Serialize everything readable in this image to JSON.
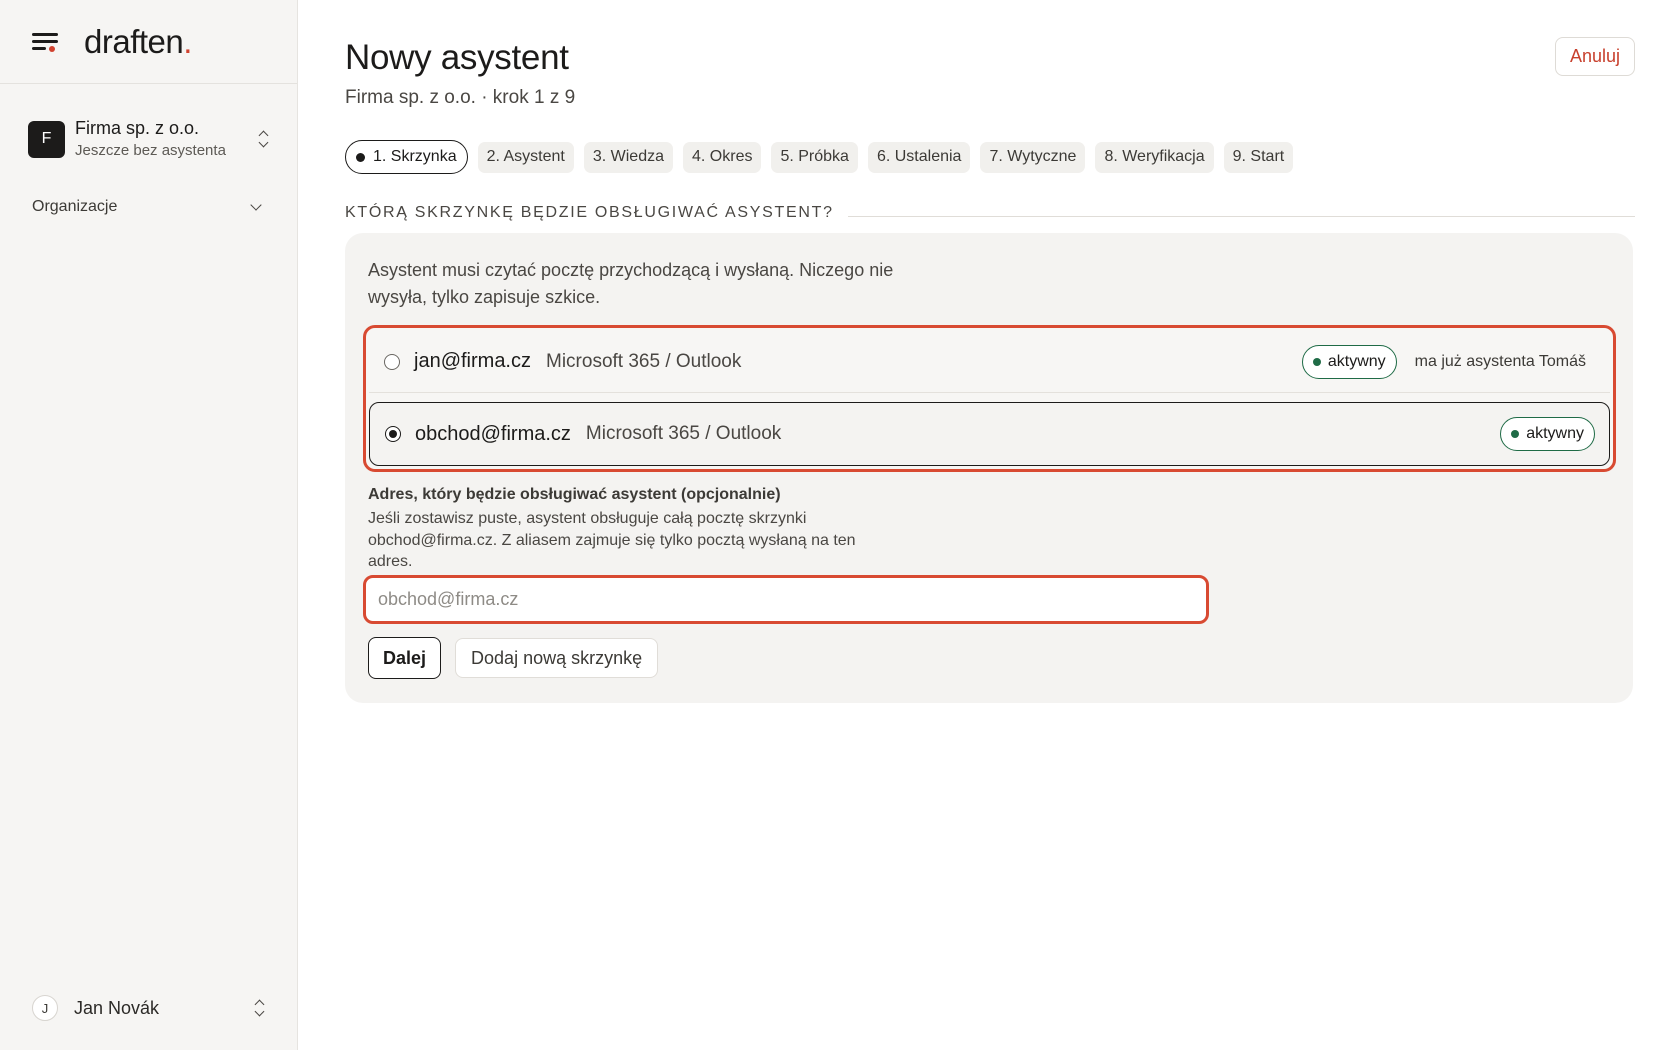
{
  "brand": {
    "name": "draften",
    "dot": "."
  },
  "sidebar": {
    "org": {
      "initial": "F",
      "name": "Firma sp. z o.o.",
      "subtitle": "Jeszcze bez asystenta"
    },
    "section_label": "Organizacje",
    "user": {
      "initial": "J",
      "name": "Jan Novák"
    }
  },
  "header": {
    "title": "Nowy asystent",
    "subtitle": "Firma sp. z o.o. · krok 1 z 9",
    "cancel_label": "Anuluj"
  },
  "steps": [
    {
      "label": "1. Skrzynka",
      "active": true
    },
    {
      "label": "2. Asystent"
    },
    {
      "label": "3. Wiedza"
    },
    {
      "label": "4. Okres"
    },
    {
      "label": "5. Próbka"
    },
    {
      "label": "6. Ustalenia"
    },
    {
      "label": "7. Wytyczne"
    },
    {
      "label": "8. Weryfikacja"
    },
    {
      "label": "9. Start"
    }
  ],
  "section": {
    "heading": "KTÓRĄ SKRZYNKĘ BĘDZIE OBSŁUGIWAĆ ASYSTENT?"
  },
  "card": {
    "description": "Asystent musi czytać pocztę przychodzącą i wysłaną. Niczego nie wysyła, tylko zapisuje szkice.",
    "mailboxes": [
      {
        "address": "jan@firma.cz",
        "provider": "Microsoft 365 / Outlook",
        "status": "aktywny",
        "note": "ma już asystenta Tomáš",
        "selected": false
      },
      {
        "address": "obchod@firma.cz",
        "provider": "Microsoft 365 / Outlook",
        "status": "aktywny",
        "note": "",
        "selected": true
      }
    ],
    "alias": {
      "label": "Adres, który będzie obsługiwać asystent (opcjonalnie)",
      "help": "Jeśli zostawisz puste, asystent obsługuje całą pocztę skrzynki obchod@firma.cz. Z aliasem zajmuje się tylko pocztą wysłaną na ten adres.",
      "value": "",
      "placeholder": "obchod@firma.cz"
    },
    "next_label": "Dalej",
    "add_mailbox_label": "Dodaj nową skrzynkę"
  },
  "colors": {
    "accent": "#d1422f",
    "highlight_border": "#d84a32",
    "status_green": "#1f6b46",
    "sidebar_bg": "#f6f5f3",
    "card_bg": "#f4f3f1"
  },
  "icons": {
    "menu": "menu-icon",
    "org_switch": "chevron-up-down-icon",
    "section_toggle": "chevron-down-icon",
    "user_switch": "chevron-up-down-icon",
    "status": "status-dot-icon"
  }
}
